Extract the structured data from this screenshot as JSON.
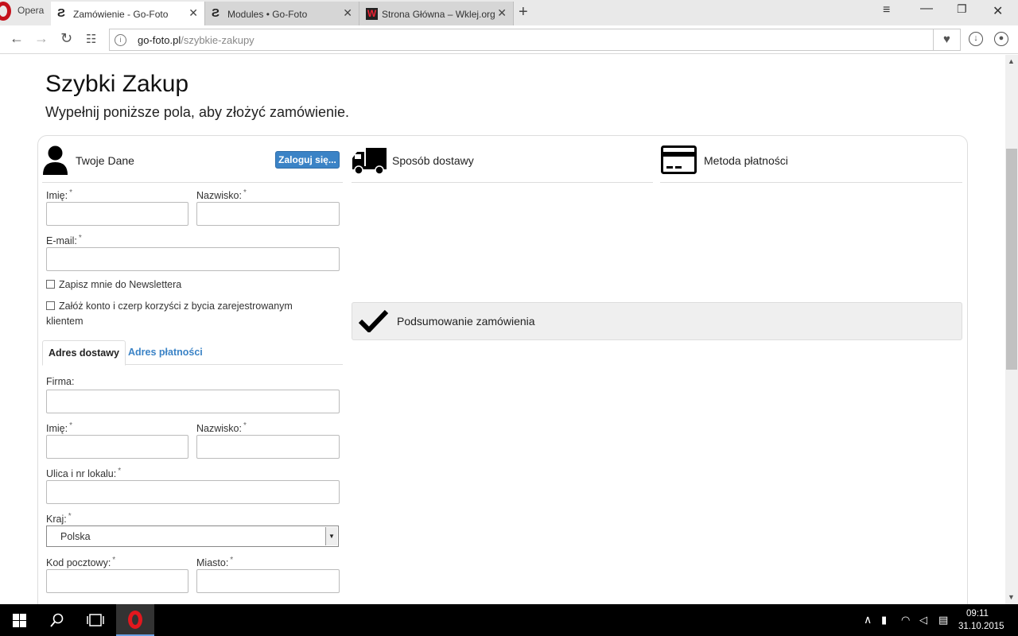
{
  "browser": {
    "menu_label": "Opera",
    "tabs": [
      {
        "title": "Zamówienie - Go-Foto",
        "icon": "go-foto-icon"
      },
      {
        "title": "Modules • Go-Foto",
        "icon": "go-foto-icon"
      },
      {
        "title": "Strona Główna – Wklej.org",
        "icon": "wklej-icon"
      }
    ],
    "url_host": "go-foto.pl",
    "url_path": "/szybkie-zakupy"
  },
  "page": {
    "title": "Szybki Zakup",
    "subtitle": "Wypełnij poniższe pola, aby złożyć zamówienie."
  },
  "customer": {
    "heading": "Twoje Dane",
    "login_button": "Zaloguj się...",
    "first_name_label": "Imię:",
    "last_name_label": "Nazwisko:",
    "email_label": "E-mail:",
    "required_mark": "*",
    "newsletter_label": "Zapisz mnie do Newslettera",
    "create_account_label": "Załóż konto i czerp korzyści z bycia zarejestrowanym klientem"
  },
  "address_tabs": {
    "shipping": "Adres dostawy",
    "billing": "Adres płatności"
  },
  "shipping_form": {
    "company_label": "Firma:",
    "first_name_label": "Imię:",
    "last_name_label": "Nazwisko:",
    "street_label": "Ulica i nr lokalu:",
    "country_label": "Kraj:",
    "country_value": "Polska",
    "postcode_label": "Kod pocztowy:",
    "city_label": "Miasto:"
  },
  "delivery": {
    "heading": "Sposób dostawy"
  },
  "payment": {
    "heading": "Metoda płatności"
  },
  "summary": {
    "heading": "Podsumowanie zamówienia"
  },
  "taskbar": {
    "time": "09:11",
    "date": "31.10.2015"
  }
}
